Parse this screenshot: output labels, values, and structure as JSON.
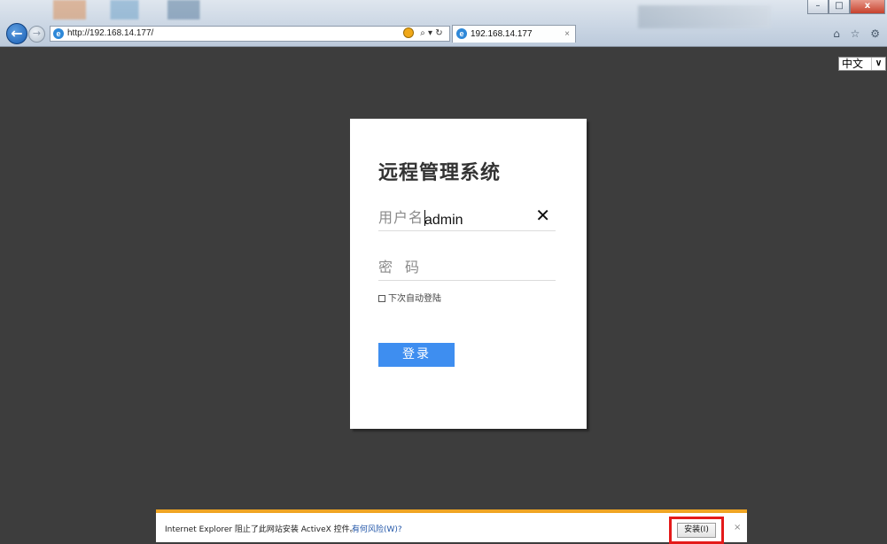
{
  "browser": {
    "url": "http://192.168.14.177/",
    "search_icon": "search-icon",
    "refresh_icon": "refresh-icon",
    "tab_title": "192.168.14.177",
    "tab_close": "×",
    "window_minimize": "–",
    "window_restore": "□",
    "window_close": "x",
    "toolbar_icons": "⌂ ☆ ⚙"
  },
  "language": {
    "selected": "中文"
  },
  "login": {
    "title": "远程管理系统",
    "username_label": "用户名",
    "username_value": "admin",
    "clear_symbol": "✕",
    "password_label": "密码",
    "remember_label": "下次自动登陆",
    "remember_checked": false,
    "submit_label": "登录"
  },
  "notification": {
    "message": "Internet Explorer 阻止了此网站安装 ActiveX 控件。",
    "risk_link": "有何风险(W)?",
    "install_label": "安装(I)",
    "close_symbol": "×"
  },
  "colors": {
    "page_background": "#3d3d3d",
    "primary_button": "#3e8ef0",
    "notification_accent": "#f0a523",
    "highlight_box": "#e41a1a"
  }
}
